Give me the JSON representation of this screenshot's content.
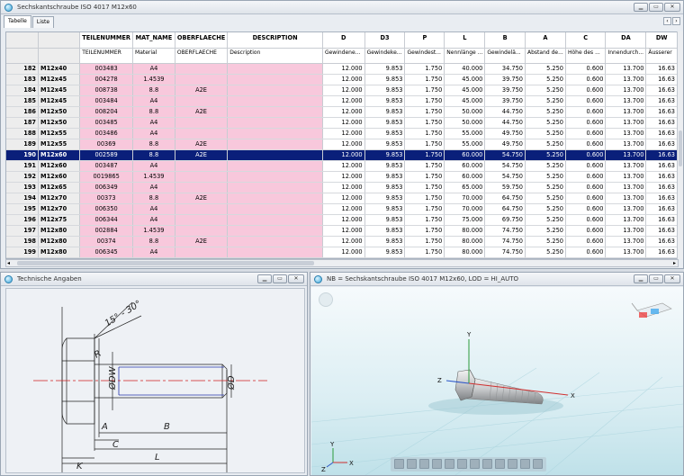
{
  "main_window": {
    "title": "Sechskantschraube ISO 4017 M12x60"
  },
  "tabs": [
    {
      "label": "Tabelle"
    },
    {
      "label": "Liste"
    }
  ],
  "tab_nav": {
    "prev": "‹",
    "next": "›"
  },
  "columns": {
    "h1": [
      "",
      "",
      "TEILENUMMER",
      "MAT_NAME",
      "OBERFLAECHE",
      "DESCRIPTION",
      "D",
      "D3",
      "P",
      "L",
      "B",
      "A",
      "C",
      "DA",
      "DW"
    ],
    "h2": [
      "",
      "",
      "TEILENUMMER",
      "Material",
      "OBERFLAECHE",
      "Description",
      "Gewindene...",
      "Gewindeke...",
      "Gewindest...",
      "Nennlänge ...",
      "Gewindelä...",
      "Abstand de...",
      "Höhe des ...",
      "Innendurch...",
      "Äusserer"
    ]
  },
  "rows": [
    [
      "182",
      "M12x40",
      "003483",
      "A4",
      "",
      "",
      "12.000",
      "9.853",
      "1.750",
      "40.000",
      "34.750",
      "5.250",
      "0.600",
      "13.700",
      "16.63"
    ],
    [
      "183",
      "M12x45",
      "004278",
      "1.4539",
      "",
      "",
      "12.000",
      "9.853",
      "1.750",
      "45.000",
      "39.750",
      "5.250",
      "0.600",
      "13.700",
      "16.63"
    ],
    [
      "184",
      "M12x45",
      "008738",
      "8.8",
      "A2E",
      "",
      "12.000",
      "9.853",
      "1.750",
      "45.000",
      "39.750",
      "5.250",
      "0.600",
      "13.700",
      "16.63"
    ],
    [
      "185",
      "M12x45",
      "003484",
      "A4",
      "",
      "",
      "12.000",
      "9.853",
      "1.750",
      "45.000",
      "39.750",
      "5.250",
      "0.600",
      "13.700",
      "16.63"
    ],
    [
      "186",
      "M12x50",
      "008204",
      "8.8",
      "A2E",
      "",
      "12.000",
      "9.853",
      "1.750",
      "50.000",
      "44.750",
      "5.250",
      "0.600",
      "13.700",
      "16.63"
    ],
    [
      "187",
      "M12x50",
      "003485",
      "A4",
      "",
      "",
      "12.000",
      "9.853",
      "1.750",
      "50.000",
      "44.750",
      "5.250",
      "0.600",
      "13.700",
      "16.63"
    ],
    [
      "188",
      "M12x55",
      "003486",
      "A4",
      "",
      "",
      "12.000",
      "9.853",
      "1.750",
      "55.000",
      "49.750",
      "5.250",
      "0.600",
      "13.700",
      "16.63"
    ],
    [
      "189",
      "M12x55",
      "00369",
      "8.8",
      "A2E",
      "",
      "12.000",
      "9.853",
      "1.750",
      "55.000",
      "49.750",
      "5.250",
      "0.600",
      "13.700",
      "16.63"
    ],
    [
      "190",
      "M12x60",
      "002589",
      "8.8",
      "A2E",
      "",
      "12.000",
      "9.853",
      "1.750",
      "60.000",
      "54.750",
      "5.250",
      "0.600",
      "13.700",
      "16.63"
    ],
    [
      "191",
      "M12x60",
      "003487",
      "A4",
      "",
      "",
      "12.000",
      "9.853",
      "1.750",
      "60.000",
      "54.750",
      "5.250",
      "0.600",
      "13.700",
      "16.63"
    ],
    [
      "192",
      "M12x60",
      "0019865",
      "1.4539",
      "",
      "",
      "12.000",
      "9.853",
      "1.750",
      "60.000",
      "54.750",
      "5.250",
      "0.600",
      "13.700",
      "16.63"
    ],
    [
      "193",
      "M12x65",
      "006349",
      "A4",
      "",
      "",
      "12.000",
      "9.853",
      "1.750",
      "65.000",
      "59.750",
      "5.250",
      "0.600",
      "13.700",
      "16.63"
    ],
    [
      "194",
      "M12x70",
      "00373",
      "8.8",
      "A2E",
      "",
      "12.000",
      "9.853",
      "1.750",
      "70.000",
      "64.750",
      "5.250",
      "0.600",
      "13.700",
      "16.63"
    ],
    [
      "195",
      "M12x70",
      "006350",
      "A4",
      "",
      "",
      "12.000",
      "9.853",
      "1.750",
      "70.000",
      "64.750",
      "5.250",
      "0.600",
      "13.700",
      "16.63"
    ],
    [
      "196",
      "M12x75",
      "006344",
      "A4",
      "",
      "",
      "12.000",
      "9.853",
      "1.750",
      "75.000",
      "69.750",
      "5.250",
      "0.600",
      "13.700",
      "16.63"
    ],
    [
      "197",
      "M12x80",
      "002884",
      "1.4539",
      "",
      "",
      "12.000",
      "9.853",
      "1.750",
      "80.000",
      "74.750",
      "5.250",
      "0.600",
      "13.700",
      "16.63"
    ],
    [
      "198",
      "M12x80",
      "00374",
      "8.8",
      "A2E",
      "",
      "12.000",
      "9.853",
      "1.750",
      "80.000",
      "74.750",
      "5.250",
      "0.600",
      "13.700",
      "16.63"
    ],
    [
      "199",
      "M12x80",
      "006345",
      "A4",
      "",
      "",
      "12.000",
      "9.853",
      "1.750",
      "80.000",
      "74.750",
      "5.250",
      "0.600",
      "13.700",
      "16.63"
    ]
  ],
  "selected_row": 8,
  "tech_window": {
    "title": "Technische Angaben",
    "labels": {
      "angle": "15° - 30°",
      "r": "R",
      "dw": "ØDW",
      "d": "ØD",
      "a": "A",
      "b": "B",
      "c": "C",
      "k": "K",
      "l": "L"
    }
  },
  "view_window": {
    "title": "NB = Sechskantschraube ISO 4017 M12x60, LOD = HI_AUTO",
    "axes": {
      "x": "X",
      "y": "Y",
      "z": "Z"
    }
  },
  "colors": {
    "selection": "#0a1f7a",
    "pink_column": "#f8c8dc",
    "accent": "#3ca7dc"
  },
  "icons": [
    "app-icon",
    "minimize-icon",
    "maximize-icon",
    "close-icon",
    "3d-glasses-icon",
    "navigation-ball-icon"
  ]
}
